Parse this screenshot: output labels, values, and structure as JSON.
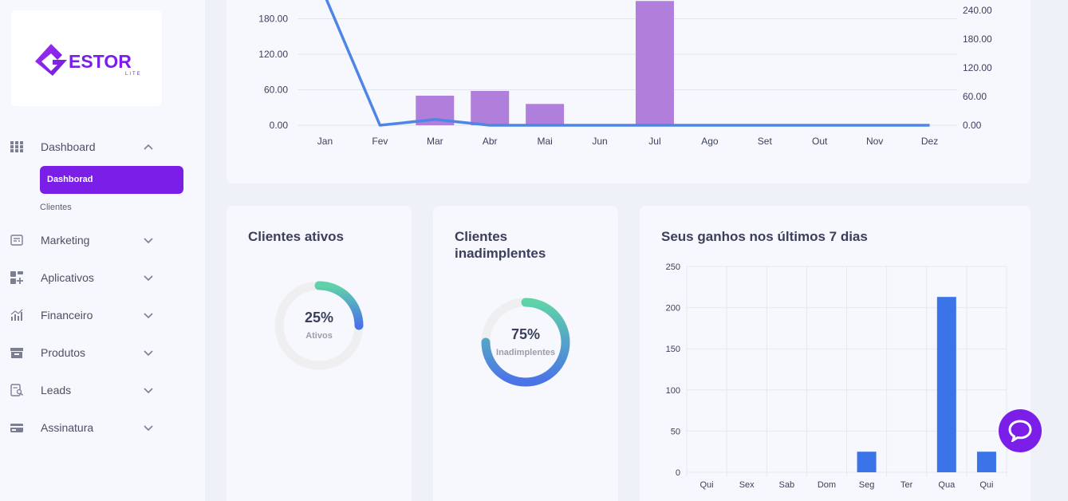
{
  "logo": {
    "text": "ESTOR",
    "sub": "LITE"
  },
  "sidebar": {
    "items": [
      {
        "label": "Dashboard",
        "icon": "grid-icon"
      },
      {
        "label": "Marketing",
        "icon": "newspaper-icon"
      },
      {
        "label": "Aplicativos",
        "icon": "apps-icon"
      },
      {
        "label": "Financeiro",
        "icon": "chart-icon"
      },
      {
        "label": "Produtos",
        "icon": "box-icon"
      },
      {
        "label": "Leads",
        "icon": "leads-icon"
      },
      {
        "label": "Assinatura",
        "icon": "card-icon"
      }
    ],
    "sub_active": "Dashborad",
    "sub_link": "Clientes"
  },
  "cards": {
    "ativos": {
      "title": "Clientes ativos",
      "value": "25%",
      "label": "Ativos"
    },
    "inadimplentes": {
      "title_line1": "Clientes",
      "title_line2": "inadimplentes",
      "value": "75%",
      "label": "Inadimplentes"
    },
    "ganhos": {
      "title": "Seus ganhos nos últimos 7 dias"
    }
  },
  "colors": {
    "accent": "#7b1fe8",
    "bar_purple": "#b07fdb",
    "line_blue": "#4f86e6",
    "bar_blue": "#3b74e8"
  },
  "chart_data": [
    {
      "type": "bar",
      "categories": [
        "Jan",
        "Fev",
        "Mar",
        "Abr",
        "Mai",
        "Jun",
        "Jul",
        "Ago",
        "Set",
        "Out",
        "Nov",
        "Dez"
      ],
      "series": [
        {
          "type": "bar",
          "axis": "left",
          "values": [
            0,
            0,
            50,
            58,
            36,
            0,
            210,
            0,
            0,
            0,
            0,
            0
          ]
        },
        {
          "type": "line",
          "axis": "right",
          "values": [
            270,
            0,
            12,
            0,
            0,
            0,
            0,
            0,
            0,
            0,
            0,
            0
          ]
        }
      ],
      "y_left_ticks": [
        "0.00",
        "60.00",
        "120.00",
        "180.00"
      ],
      "y_right_ticks": [
        "0.00",
        "60.00",
        "120.00",
        "180.00",
        "240.00"
      ],
      "ylim_left": [
        0,
        200
      ],
      "ylim_right": [
        0,
        260
      ]
    },
    {
      "type": "bar",
      "categories": [
        "Qui",
        "Sex",
        "Sab",
        "Dom",
        "Seg",
        "Ter",
        "Qua",
        "Qui"
      ],
      "values": [
        0,
        0,
        0,
        0,
        25,
        0,
        213,
        25
      ],
      "y_ticks": [
        "0",
        "50",
        "100",
        "150",
        "200",
        "250"
      ],
      "ylim": [
        0,
        250
      ]
    },
    {
      "type": "pie",
      "values": [
        25,
        75
      ],
      "labels": [
        "Ativos",
        ""
      ]
    },
    {
      "type": "pie",
      "values": [
        75,
        25
      ],
      "labels": [
        "Inadimplentes",
        ""
      ]
    }
  ]
}
